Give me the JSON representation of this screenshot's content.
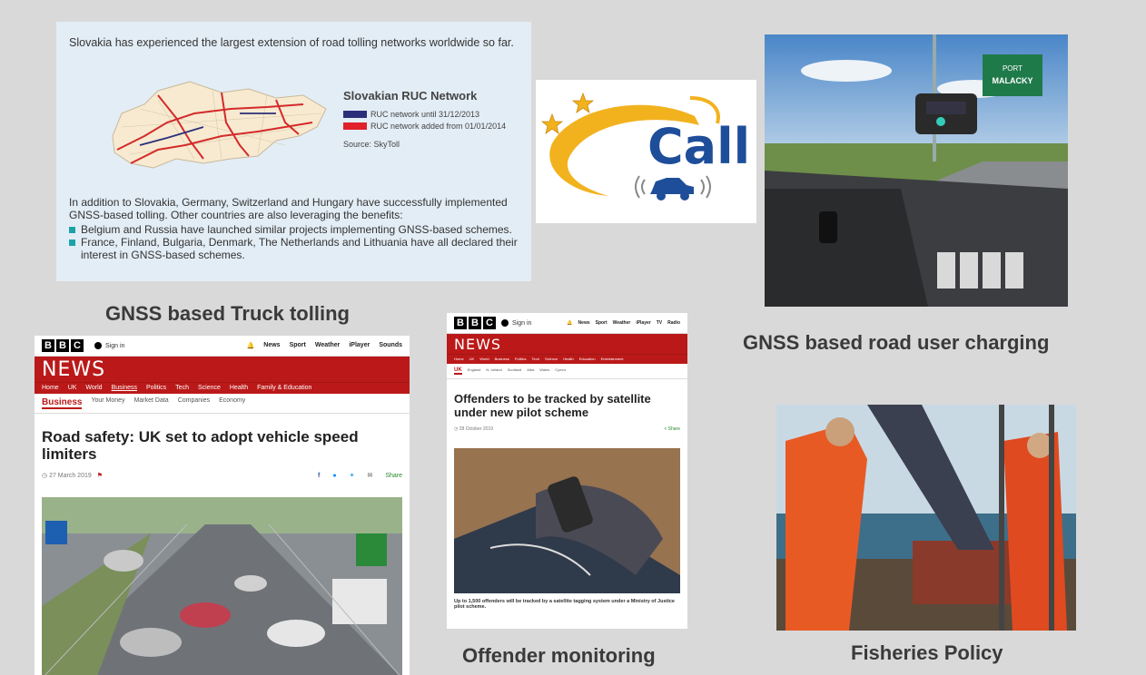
{
  "slovakia": {
    "intro": "Slovakia has experienced the largest extension of road tolling networks worldwide so far.",
    "legend_title": "Slovakian RUC Network",
    "legend": [
      {
        "label": "RUC network until 31/12/2013",
        "color": "#2b2f7a"
      },
      {
        "label": "RUC network added from 01/01/2014",
        "color": "#e0202a"
      }
    ],
    "source": "Source: SkyToll",
    "body": "In addition to Slovakia, Germany, Switzerland and Hungary have successfully implemented GNSS-based tolling. Other countries are also leveraging the benefits:",
    "bullets": [
      "Belgium and Russia have launched similar projects implementing GNSS-based schemes.",
      "France, Finland, Bulgaria, Denmark, The Netherlands and Lithuania have all declared their interest in GNSS-based schemes."
    ]
  },
  "ecall": {
    "text": "Call"
  },
  "captions": {
    "truck_tolling": "GNSS based Truck tolling",
    "road_user_charging": "GNSS based road user charging",
    "offender": "Offender monitoring",
    "fisheries": "Fisheries Policy"
  },
  "truck_photo": {
    "sign_line1": "PORT",
    "sign_line2": "MALACKY"
  },
  "bbc1": {
    "logo": [
      "B",
      "B",
      "C"
    ],
    "sign_in": "Sign in",
    "nav": [
      "News",
      "Sport",
      "Weather",
      "iPlayer",
      "Sounds"
    ],
    "news": "NEWS",
    "menu": [
      "Home",
      "UK",
      "World",
      "Business",
      "Politics",
      "Tech",
      "Science",
      "Health",
      "Family & Education"
    ],
    "subnav_active": "Business",
    "subnav": [
      "Your Money",
      "Market Data",
      "Companies",
      "Economy"
    ],
    "headline": "Road safety: UK set to adopt vehicle speed limiters",
    "date": "27 March 2019",
    "share": "Share"
  },
  "bbc2": {
    "logo": [
      "B",
      "B",
      "C"
    ],
    "sign_in": "Sign in",
    "nav": [
      "News",
      "Sport",
      "Weather",
      "iPlayer",
      "TV",
      "Radio"
    ],
    "news": "NEWS",
    "menu": [
      "Home",
      "UK",
      "World",
      "Business",
      "Politics",
      "Tech",
      "Science",
      "Health",
      "Education",
      "Entertainment"
    ],
    "subnav_active": "UK",
    "subnav": [
      "England",
      "N. Ireland",
      "Scotland",
      "Alba",
      "Wales",
      "Cymru"
    ],
    "headline": "Offenders to be tracked by satellite under new pilot scheme",
    "date": "28 October 2019",
    "share": "Share",
    "caption": "Up to 1,500 offenders will be tracked by a satellite tagging system under a Ministry of Justice pilot scheme."
  }
}
